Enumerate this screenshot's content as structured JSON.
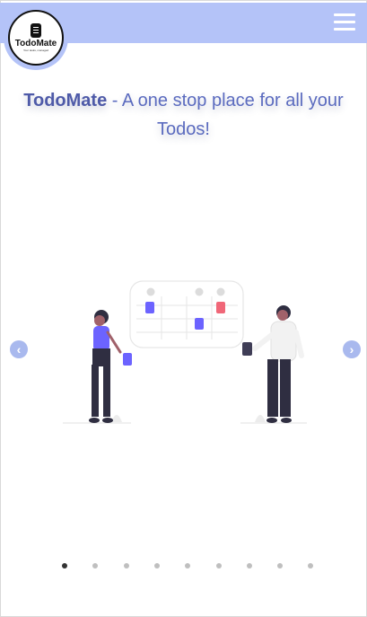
{
  "logo": {
    "title": "TodoMate",
    "tagline": "Your tasks, managed"
  },
  "headline": {
    "brand": "TodoMate",
    "rest": " - A one stop place for all your Todos!"
  },
  "carousel": {
    "slide_count": 9,
    "active_index": 0
  },
  "colors": {
    "navbar": "#b4c3f8",
    "accent": "#5b6bbf",
    "purple": "#6c63ff",
    "pink": "#f06778"
  }
}
